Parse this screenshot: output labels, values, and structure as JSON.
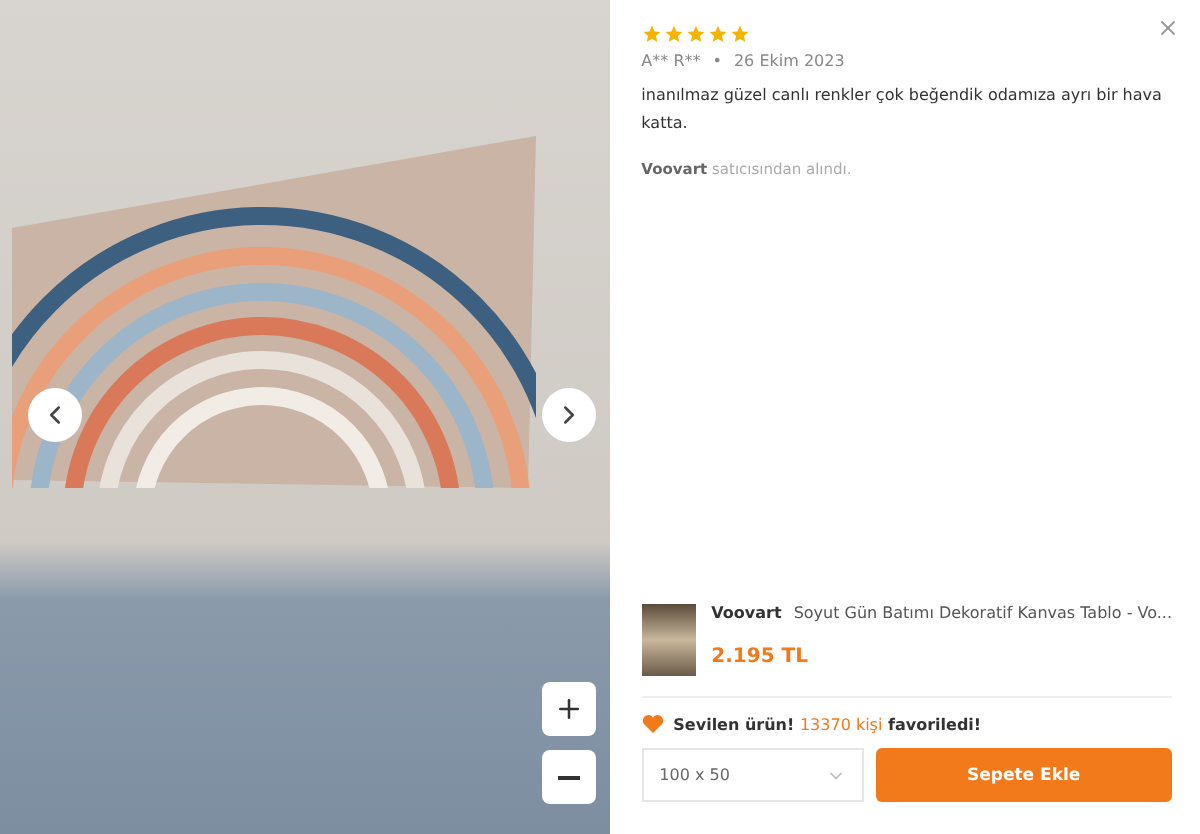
{
  "review": {
    "stars": 5,
    "author": "A** R**",
    "separator": "•",
    "date": "26 Ekim 2023",
    "text": "inanılmaz güzel canlı renkler çok beğendik odamıza ayrı bir hava katta.",
    "seller": "Voovart",
    "seller_note": "satıcısından alındı."
  },
  "product": {
    "brand": "Voovart",
    "title": "Soyut Gün Batımı Dekoratif Kanvas Tablo - Vo...",
    "price": "2.195 TL"
  },
  "favorite": {
    "lead": "Sevilen ürün!",
    "count": "13370 kişi",
    "tail": "favoriledi!"
  },
  "size_select": {
    "value": "100 x 50"
  },
  "add_to_cart": "Sepete Ekle"
}
